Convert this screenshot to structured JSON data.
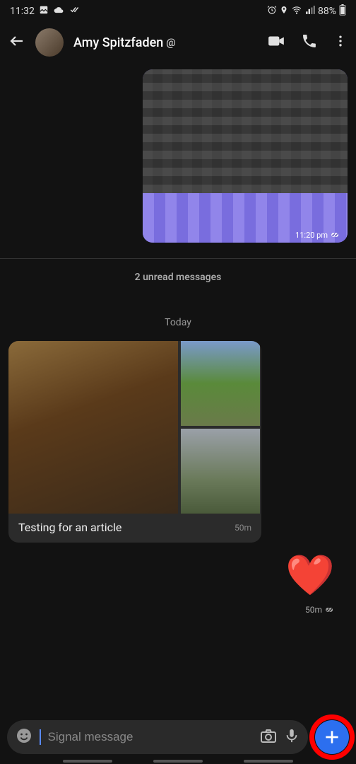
{
  "status_bar": {
    "time": "11:32",
    "battery": "88%",
    "icons": {
      "gallery": "gallery-icon",
      "cloud": "cloud-icon",
      "checks": "double-check-icon",
      "alarm": "alarm-icon",
      "location": "location-icon",
      "wifi": "wifi-icon",
      "signal": "signal-icon",
      "battery_icon": "battery-icon"
    }
  },
  "header": {
    "contact_name": "Amy Spitzfaden",
    "badge": "@"
  },
  "messages": {
    "outgoing1": {
      "time": "11:20 pm"
    },
    "unread_label": "2 unread messages",
    "date_label": "Today",
    "incoming1": {
      "caption": "Testing for an article",
      "time": "50m"
    },
    "reaction": {
      "emoji": "❤️",
      "time": "50m"
    }
  },
  "composer": {
    "placeholder": "Signal message"
  }
}
